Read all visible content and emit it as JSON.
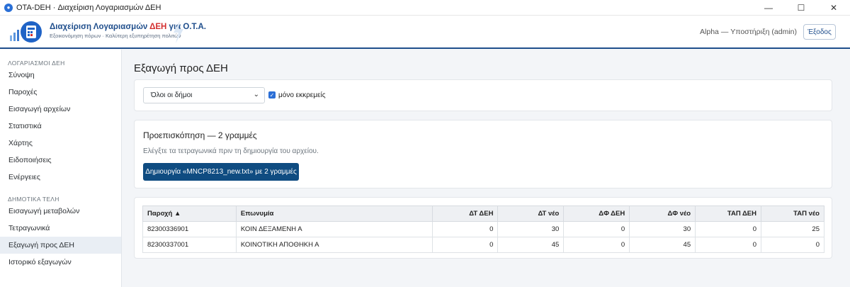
{
  "window": {
    "title": "OTA-DEH · Διαχείριση Λογαριασμών ΔΕΗ",
    "minimize": "—",
    "maximize": "☐",
    "close": "✕"
  },
  "header": {
    "brand_title_main": "Διαχείριση Λογαριασμών ",
    "brand_title_accent": "ΔΕΗ",
    "brand_title_tail": " για Ο.Τ.Α.",
    "brand_subtitle": "Εξοικονόμηση πόρων · Καλύτερη εξυπηρέτηση πολιτών",
    "user": "Alpha — Υποστήριξη (admin)",
    "logout": "Έξοδος"
  },
  "sidebar": {
    "sections": [
      {
        "label": "ΛΟΓΑΡΙΑΣΜΟΙ ΔΕΗ",
        "items": [
          "Σύνοψη",
          "Παροχές",
          "Εισαγωγή αρχείων",
          "Στατιστικά",
          "Χάρτης",
          "Ειδοποιήσεις",
          "Ενέργειες"
        ]
      },
      {
        "label": "ΔΗΜΟΤΙΚΑ ΤΕΛΗ",
        "items": [
          "Εισαγωγή μεταβολών",
          "Τετραγωνικά",
          "Εξαγωγή προς ΔΕΗ",
          "Ιστορικό εξαγωγών"
        ]
      }
    ],
    "active": "Εξαγωγή προς ΔΕΗ"
  },
  "main": {
    "page_title": "Εξαγωγή προς ΔΕΗ",
    "filters": {
      "municipality_select": "Όλοι οι δήμοι",
      "pending_only_label": "μόνο εκκρεμείς",
      "pending_only_checked": true
    },
    "preview": {
      "title": "Προεπισκόπηση — 2 γραμμές",
      "hint": "Ελέγξτε τα τετραγωνικά πριν τη δημιουργία του αρχείου.",
      "create_button": "Δημιουργία «MNCP8213_new.txt» με 2 γραμμές"
    },
    "table": {
      "headers": [
        "Παροχή ▲",
        "Επωνυμία",
        "ΔΤ ΔΕΗ",
        "ΔΤ νέο",
        "ΔΦ ΔΕΗ",
        "ΔΦ νέο",
        "ΤΑΠ ΔΕΗ",
        "ΤΑΠ νέο"
      ],
      "rows": [
        [
          "82300336901",
          "ΚΟΙΝ ΔΕΞΑΜΕΝΗ Α",
          "0",
          "30",
          "0",
          "30",
          "0",
          "25"
        ],
        [
          "82300337001",
          "ΚΟΙΝΟΤΙΚΗ ΑΠΟΘΗΚΗ Α",
          "0",
          "45",
          "0",
          "45",
          "0",
          "0"
        ]
      ]
    }
  },
  "colors": {
    "primary": "#0f4c81",
    "brand": "#1f4e8c",
    "accent": "#d32f2f",
    "checkbox": "#2c6fd6"
  }
}
